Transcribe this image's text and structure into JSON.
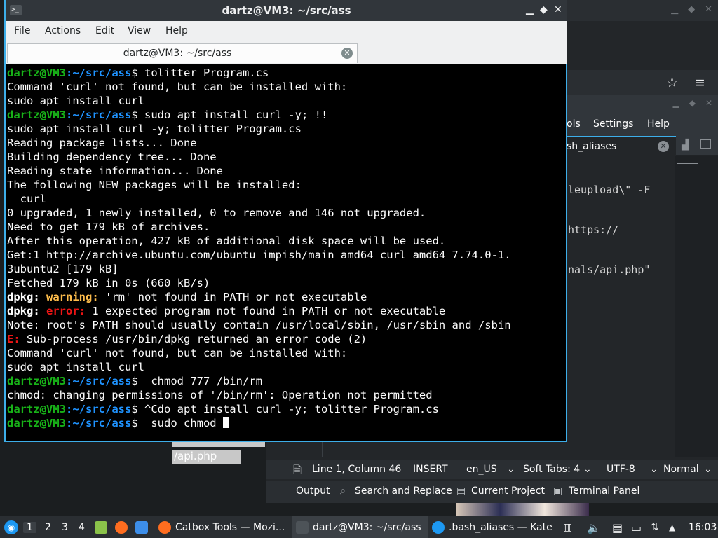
{
  "konsole": {
    "title": "dartz@VM3: ~/src/ass",
    "menu": [
      "File",
      "Actions",
      "Edit",
      "View",
      "Help"
    ],
    "tab_label": "dartz@VM3: ~/src/ass",
    "prompt_user": "dartz@VM3",
    "prompt_path": ":~/src/ass",
    "lines": [
      {
        "type": "prompt",
        "cmd": "$ tolitter Program.cs"
      },
      {
        "type": "text",
        "text": "Command 'curl' not found, but can be installed with:"
      },
      {
        "type": "text",
        "text": "sudo apt install curl"
      },
      {
        "type": "prompt",
        "cmd": "$ sudo apt install curl -y; !!"
      },
      {
        "type": "text",
        "text": "sudo apt install curl -y; tolitter Program.cs"
      },
      {
        "type": "text",
        "text": "Reading package lists... Done"
      },
      {
        "type": "text",
        "text": "Building dependency tree... Done"
      },
      {
        "type": "text",
        "text": "Reading state information... Done"
      },
      {
        "type": "text",
        "text": "The following NEW packages will be installed:"
      },
      {
        "type": "text",
        "text": "  curl"
      },
      {
        "type": "text",
        "text": "0 upgraded, 1 newly installed, 0 to remove and 146 not upgraded."
      },
      {
        "type": "text",
        "text": "Need to get 179 kB of archives."
      },
      {
        "type": "text",
        "text": "After this operation, 427 kB of additional disk space will be used."
      },
      {
        "type": "text",
        "text": "Get:1 http://archive.ubuntu.com/ubuntu impish/main amd64 curl amd64 7.74.0-1."
      },
      {
        "type": "text",
        "text": "3ubuntu2 [179 kB]"
      },
      {
        "type": "text",
        "text": "Fetched 179 kB in 0s (660 kB/s)"
      },
      {
        "type": "dpkg",
        "label": "dpkg:",
        "level": "warning:",
        "level_class": "warn",
        "text": " 'rm' not found in PATH or not executable"
      },
      {
        "type": "dpkg",
        "label": "dpkg:",
        "level": "error:",
        "level_class": "err",
        "text": " 1 expected program not found in PATH or not executable"
      },
      {
        "type": "text",
        "text": "Note: root's PATH should usually contain /usr/local/sbin, /usr/sbin and /sbin"
      },
      {
        "type": "dpkg",
        "label": "",
        "level": "E:",
        "level_class": "err",
        "text": " Sub-process /usr/bin/dpkg returned an error code (2)"
      },
      {
        "type": "text",
        "text": "Command 'curl' not found, but can be installed with:"
      },
      {
        "type": "text",
        "text": "sudo apt install curl"
      },
      {
        "type": "prompt",
        "cmd": "$  chmod 777 /bin/rm"
      },
      {
        "type": "text",
        "text": "chmod: changing permissions of '/bin/rm': Operation not permitted"
      },
      {
        "type": "prompt",
        "cmd": "$ ^Cdo apt install curl -y; tolitter Program.cs"
      },
      {
        "type": "prompt",
        "cmd": "$  sudo chmod ",
        "cursor": true
      }
    ]
  },
  "kate": {
    "menu": [
      "ols",
      "Settings",
      "Help"
    ],
    "tab_label": "sh_aliases",
    "code_lines": [
      "leupload\\\" -F",
      "https://",
      "nals/api.php\""
    ],
    "status": {
      "position": "Line 1, Column 46",
      "mode": "INSERT",
      "language": "en_US",
      "tabs": "Soft Tabs: 4",
      "encoding": "UTF-8",
      "view_mode": "Normal"
    },
    "bottom_tabs": [
      "Output",
      "Search and Replace",
      "Current Project",
      "Terminal Panel"
    ]
  },
  "desktop": {
    "selected_text": "/api.php"
  },
  "taskbar": {
    "desktops": [
      "1",
      "2",
      "3",
      "4"
    ],
    "active_desktop": "1",
    "tasks": [
      {
        "label": "Catbox Tools — Mozi..."
      },
      {
        "label": "dartz@VM3: ~/src/ass"
      },
      {
        "label": ".bash_aliases  — Kate"
      }
    ],
    "clock": "16:03"
  },
  "colors": {
    "accent": "#3daee9",
    "prompt_user": "#18b218",
    "prompt_path": "#1f93ff",
    "warning": "#fdbc4b",
    "error": "#ed1515"
  }
}
